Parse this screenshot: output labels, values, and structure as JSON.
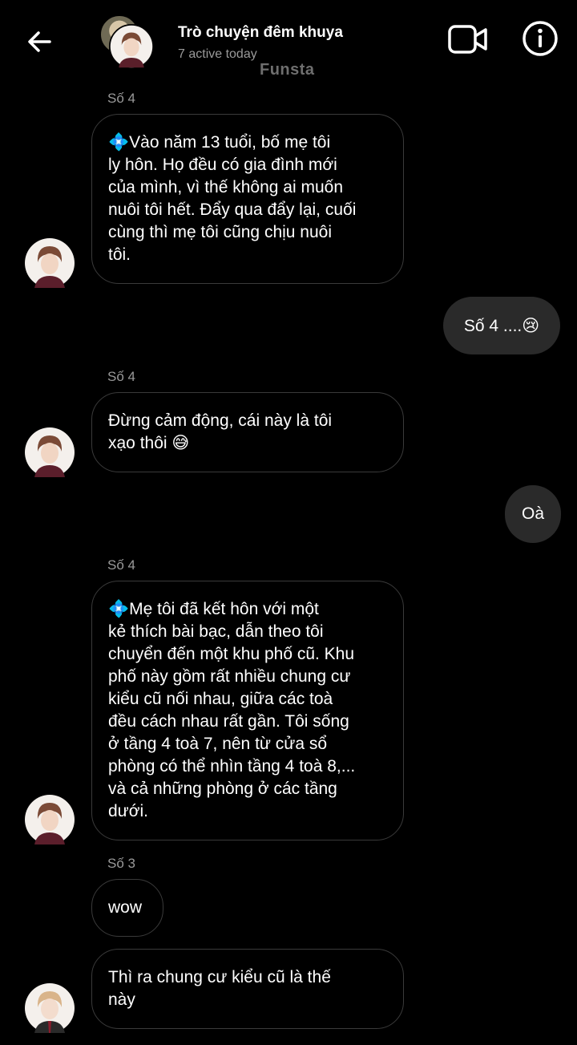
{
  "header": {
    "title": "Trò chuyện đêm khuya",
    "subtitle": "7 active today",
    "watermark": "Funsta",
    "icons": [
      "back-arrow-icon",
      "video-call-icon",
      "info-icon"
    ]
  },
  "messages": [
    {
      "sender": "Số 4",
      "text": "💠Vào năm 13 tuổi, bố mẹ tôi\nly hôn. Họ đều có gia đình mới\ncủa mình, vì thế không ai muốn\nnuôi tôi hết. Đẩy qua đẩy lại, cuối\ncùng thì mẹ tôi cũng chịu nuôi\ntôi."
    },
    {
      "outgoing": "Số 4 ....😢"
    },
    {
      "sender": "Số 4",
      "text": "Đừng cảm động, cái này là tôi\nxạo thôi 😅"
    },
    {
      "outgoing": "Oà"
    },
    {
      "sender": "Số 4",
      "text": "💠Mẹ tôi đã kết hôn với một\nkẻ thích bài bạc, dẫn theo tôi\nchuyển đến một khu phố cũ. Khu\nphố này gồm rất nhiều chung cư\nkiểu cũ nối nhau, giữa các toà\nđều cách nhau rất gần. Tôi sống\nở tầng 4 toà 7, nên từ cửa sổ\nphòng có thể nhìn tầng 4 toà 8,...\nvà cả những phòng ở các tầng\ndưới."
    },
    {
      "sender": "Số 3",
      "text": "wow"
    },
    {
      "text": "Thì ra chung cư kiểu cũ là thế\nnày"
    }
  ]
}
